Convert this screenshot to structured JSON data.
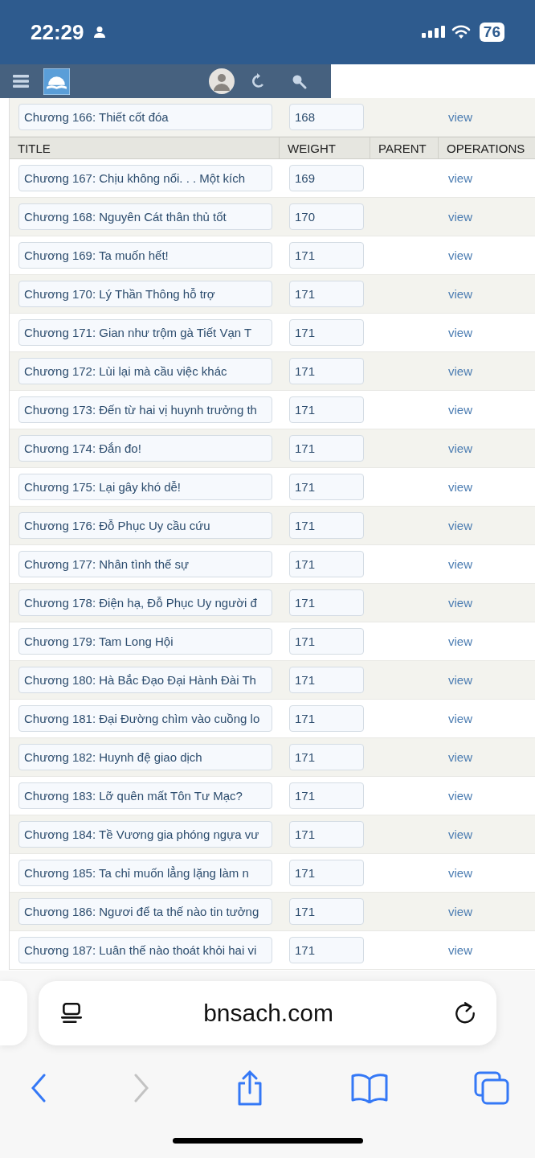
{
  "status_bar": {
    "time": "22:29",
    "battery": "76"
  },
  "table": {
    "columns": [
      "TITLE",
      "WEIGHT",
      "PARENT",
      "OPERATIONS"
    ],
    "rows": [
      {
        "title": "Chương 166: Thiết cốt đóa",
        "weight": "168",
        "operation": "view"
      },
      {
        "title": "Chương 167: Chịu không nổi. . . Một kích",
        "weight": "169",
        "operation": "view"
      },
      {
        "title": "Chương 168: Nguyên Cát thân thủ tốt",
        "weight": "170",
        "operation": "view"
      },
      {
        "title": "Chương 169: Ta muốn hết!",
        "weight": "171",
        "operation": "view"
      },
      {
        "title": "Chương 170: Lý Thần Thông hỗ trợ",
        "weight": "171",
        "operation": "view"
      },
      {
        "title": "Chương 171: Gian như trộm gà Tiết Vạn T",
        "weight": "171",
        "operation": "view"
      },
      {
        "title": "Chương 172: Lùi lại mà cầu việc khác",
        "weight": "171",
        "operation": "view"
      },
      {
        "title": "Chương 173: Đến từ hai vị huynh trưởng th",
        "weight": "171",
        "operation": "view"
      },
      {
        "title": "Chương 174: Đắn đo!",
        "weight": "171",
        "operation": "view"
      },
      {
        "title": "Chương 175: Lại gây khó dễ!",
        "weight": "171",
        "operation": "view"
      },
      {
        "title": "Chương 176: Đỗ Phục Uy cầu cứu",
        "weight": "171",
        "operation": "view"
      },
      {
        "title": "Chương 177: Nhân tình thế sự",
        "weight": "171",
        "operation": "view"
      },
      {
        "title": "Chương 178: Điện hạ, Đỗ Phục Uy người đ",
        "weight": "171",
        "operation": "view"
      },
      {
        "title": "Chương 179: Tam Long Hội",
        "weight": "171",
        "operation": "view"
      },
      {
        "title": "Chương 180: Hà Bắc Đạo Đại Hành Đài Th",
        "weight": "171",
        "operation": "view"
      },
      {
        "title": "Chương 181: Đại Đường chìm vào cuồng lo",
        "weight": "171",
        "operation": "view"
      },
      {
        "title": "Chương 182: Huynh đệ giao dịch",
        "weight": "171",
        "operation": "view"
      },
      {
        "title": "Chương 183: Lỡ quên mất Tôn Tư Mạc?",
        "weight": "171",
        "operation": "view"
      },
      {
        "title": "Chương 184: Tề Vương gia phóng ngựa vư",
        "weight": "171",
        "operation": "view"
      },
      {
        "title": "Chương 185: Ta chỉ muốn lẳng lặng làm n",
        "weight": "171",
        "operation": "view"
      },
      {
        "title": "Chương 186: Ngươi để ta thế nào tin tưởng",
        "weight": "171",
        "operation": "view"
      },
      {
        "title": "Chương 187: Luân thế nào thoát khỏi hai vi",
        "weight": "171",
        "operation": "view"
      }
    ]
  },
  "browser": {
    "url": "bnsach.com",
    "back_disabled": false,
    "forward_disabled": true
  }
}
